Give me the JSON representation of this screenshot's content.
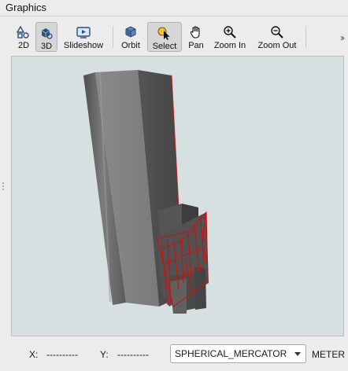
{
  "panel": {
    "title": "Graphics"
  },
  "toolbar": {
    "buttons": [
      {
        "label": "2D",
        "icon": "2d-view-icon",
        "active": false
      },
      {
        "label": "3D",
        "icon": "3d-view-icon",
        "active": true
      },
      {
        "label": "Slideshow",
        "icon": "slideshow-icon",
        "active": false
      },
      {
        "label": "Orbit",
        "icon": "orbit-cube-icon",
        "active": false
      },
      {
        "label": "Select",
        "icon": "select-cursor-icon",
        "active": true
      },
      {
        "label": "Pan",
        "icon": "hand-icon",
        "active": false
      },
      {
        "label": "Zoom In",
        "icon": "zoom-in-icon",
        "active": false
      },
      {
        "label": "Zoom Out",
        "icon": "zoom-out-icon",
        "active": false
      }
    ],
    "overflow": "››"
  },
  "viewport": {
    "background": "#d6e0e0",
    "selection_color": "#cc1111"
  },
  "status": {
    "x_label": "X:",
    "x_value": "----------",
    "y_label": "Y:",
    "y_value": "----------",
    "projection": "SPHERICAL_MERCATOR",
    "units": "METER"
  }
}
